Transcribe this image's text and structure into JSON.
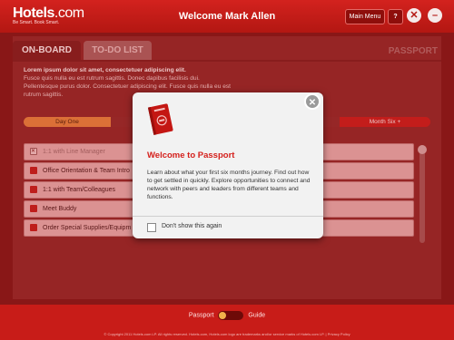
{
  "header": {
    "logo_text": "Hotels",
    "logo_suffix": ".com",
    "logo_tagline": "Be Smart. Book Smart.",
    "welcome": "Welcome Mark Allen",
    "menu_label": "Main Menu",
    "help_label": "?",
    "close_label": "✕",
    "minimize_label": "–"
  },
  "tabs": [
    {
      "label": "ON-BOARD"
    },
    {
      "label": "TO-DO LIST"
    }
  ],
  "passport_label": "PASSPORT",
  "intro": {
    "lead": "Lorem ipsum dolor sit amet, consectetuer adipiscing elit.",
    "body": "Fusce quis nulla eu est rutrum sagittis. Donec dapibus facilisis dui. Pellentesque purus dolor. Consectetuer adipiscing elit. Fusce quis nulla eu est rutrum sagittis."
  },
  "timeline": {
    "start_label": "Day One",
    "end_label": "Month Six +"
  },
  "list": [
    {
      "label": "1:1 with Line Manager",
      "done": true
    },
    {
      "label": "Office Orientation & Team Intro",
      "done": false
    },
    {
      "label": "1:1 with Team/Colleagues",
      "done": false
    },
    {
      "label": "Meet Buddy",
      "done": false
    },
    {
      "label": "Order Special Supplies/Equipm",
      "done": false
    }
  ],
  "modal": {
    "title": "Welcome to Passport",
    "body": "Learn about what your first six months journey. Find out how to get settled in quickly. Explore opportunities to connect and network with peers and leaders from different teams and functions.",
    "checkbox_label": "Don't show this again",
    "close_label": "✕",
    "icon": "passport-book-icon"
  },
  "footer": {
    "toggle_left": "Passport",
    "toggle_right": "Guide",
    "copyright": "© Copyright 2011 Hotels.com LP.  All rights reserved. Hotels.com, Hotels.com logo are trademarks and/or service marks of Hotels.com LP.  |  Privacy Policy"
  },
  "colors": {
    "brand_red": "#d3221e",
    "accent_orange": "#e88b3f"
  }
}
